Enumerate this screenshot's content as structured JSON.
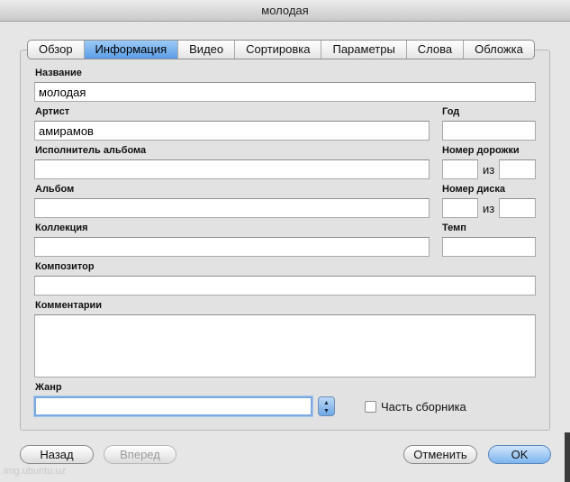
{
  "window": {
    "title": "молодая"
  },
  "tabs": [
    {
      "label": "Обзор",
      "active": false
    },
    {
      "label": "Информация",
      "active": true
    },
    {
      "label": "Видео",
      "active": false
    },
    {
      "label": "Сортировка",
      "active": false
    },
    {
      "label": "Параметры",
      "active": false
    },
    {
      "label": "Слова",
      "active": false
    },
    {
      "label": "Обложка",
      "active": false
    }
  ],
  "form": {
    "name": {
      "label": "Название",
      "value": "молодая"
    },
    "artist": {
      "label": "Артист",
      "value": "амирамов"
    },
    "year": {
      "label": "Год",
      "value": ""
    },
    "album_artist": {
      "label": "Исполнитель альбома",
      "value": ""
    },
    "track_number": {
      "label": "Номер дорожки",
      "value": "",
      "of_label": "из",
      "of_value": ""
    },
    "album": {
      "label": "Альбом",
      "value": ""
    },
    "disc_number": {
      "label": "Номер диска",
      "value": "",
      "of_label": "из",
      "of_value": ""
    },
    "grouping": {
      "label": "Коллекция",
      "value": ""
    },
    "bpm": {
      "label": "Темп",
      "value": ""
    },
    "composer": {
      "label": "Композитор",
      "value": ""
    },
    "comments": {
      "label": "Комментарии",
      "value": ""
    },
    "genre": {
      "label": "Жанр",
      "value": ""
    },
    "compilation": {
      "label": "Часть сборника",
      "checked": false
    },
    "stepper_up": "▲",
    "stepper_down": "▼"
  },
  "buttons": {
    "back": "Назад",
    "forward": "Вперед",
    "cancel": "Отменить",
    "ok": "OK"
  },
  "watermark": "img.ubuntu.uz",
  "colors": {
    "accent": "#5c9de6",
    "focus_ring": "#7aa8e0",
    "window_bg": "#e6e6e6"
  }
}
